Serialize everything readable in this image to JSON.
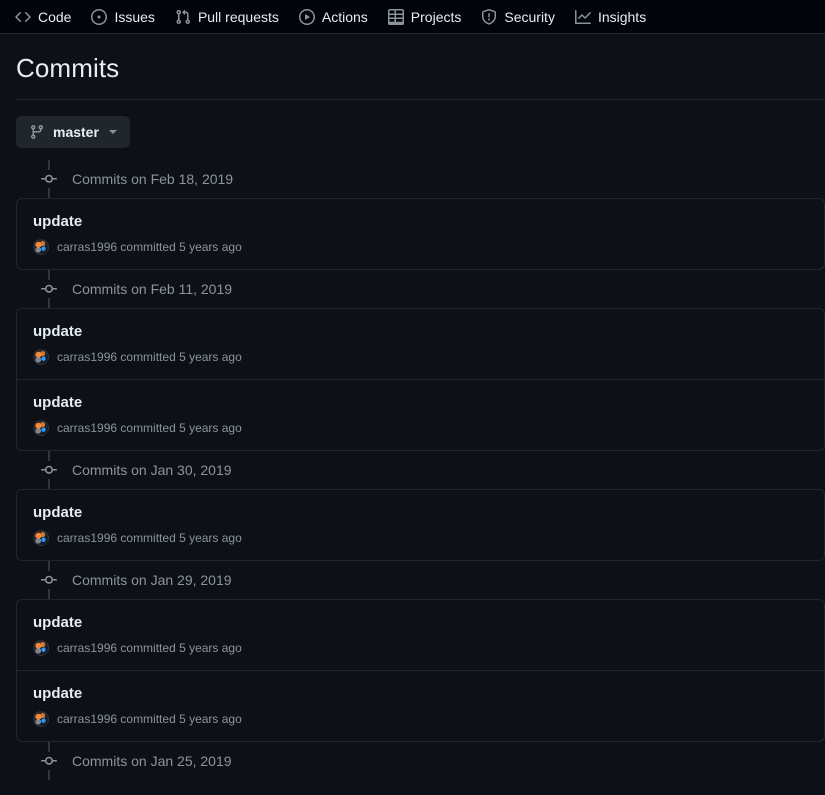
{
  "repo_nav": {
    "items": [
      {
        "label": "Code",
        "icon": "code-icon"
      },
      {
        "label": "Issues",
        "icon": "issue-opened-icon"
      },
      {
        "label": "Pull requests",
        "icon": "git-pull-request-icon"
      },
      {
        "label": "Actions",
        "icon": "play-icon"
      },
      {
        "label": "Projects",
        "icon": "table-icon"
      },
      {
        "label": "Security",
        "icon": "shield-icon"
      },
      {
        "label": "Insights",
        "icon": "graph-icon"
      }
    ]
  },
  "page": {
    "title": "Commits"
  },
  "branch_selector": {
    "label": "master",
    "icon": "git-branch-icon",
    "caret": "chevron-down-icon"
  },
  "commit_groups": [
    {
      "date_label": "Commits on Feb 18, 2019",
      "node_icon": "git-commit-icon",
      "commits": [
        {
          "message": "update",
          "author": "carras1996",
          "meta": "committed 5 years ago",
          "avatar": "user-avatar"
        }
      ]
    },
    {
      "date_label": "Commits on Feb 11, 2019",
      "node_icon": "git-commit-icon",
      "commits": [
        {
          "message": "update",
          "author": "carras1996",
          "meta": "committed 5 years ago",
          "avatar": "user-avatar"
        },
        {
          "message": "update",
          "author": "carras1996",
          "meta": "committed 5 years ago",
          "avatar": "user-avatar"
        }
      ]
    },
    {
      "date_label": "Commits on Jan 30, 2019",
      "node_icon": "git-commit-icon",
      "commits": [
        {
          "message": "update",
          "author": "carras1996",
          "meta": "committed 5 years ago",
          "avatar": "user-avatar"
        }
      ]
    },
    {
      "date_label": "Commits on Jan 29, 2019",
      "node_icon": "git-commit-icon",
      "commits": [
        {
          "message": "update",
          "author": "carras1996",
          "meta": "committed 5 years ago",
          "avatar": "user-avatar"
        },
        {
          "message": "update",
          "author": "carras1996",
          "meta": "committed 5 years ago",
          "avatar": "user-avatar"
        }
      ]
    },
    {
      "date_label": "Commits on Jan 25, 2019",
      "node_icon": "git-commit-icon",
      "commits": []
    }
  ],
  "colors": {
    "canvas": "#0d1117",
    "header_bg": "#010409",
    "border": "#21262d",
    "text": "#e6edf3",
    "text_muted": "#8b949e",
    "button_bg": "#21262d"
  }
}
